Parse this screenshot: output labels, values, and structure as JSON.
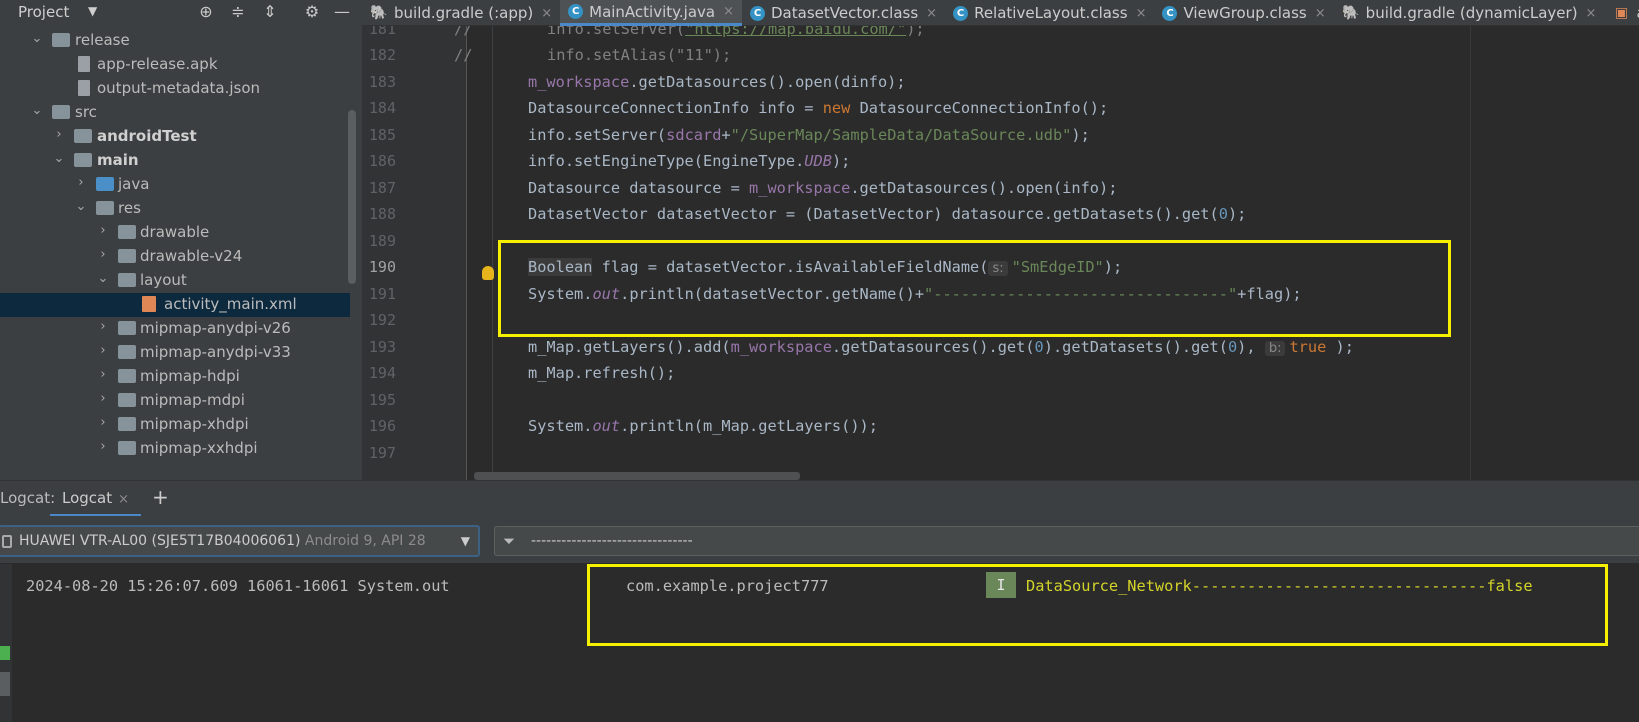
{
  "project_panel": {
    "title": "Project",
    "caret": "▼",
    "tools": [
      "⊕",
      "≑",
      "⇕",
      "⚙",
      "—"
    ]
  },
  "tabs": [
    {
      "label": "build.gradle (:app)",
      "icon": "gradle-icon",
      "close": "×",
      "active": false
    },
    {
      "label": "MainActivity.java",
      "icon": "class-icon",
      "close": "×",
      "active": true
    },
    {
      "label": "DatasetVector.class",
      "icon": "class-icon",
      "close": "×",
      "active": false
    },
    {
      "label": "RelativeLayout.class",
      "icon": "class-icon",
      "close": "×",
      "active": false
    },
    {
      "label": "ViewGroup.class",
      "icon": "class-icon",
      "close": "×",
      "active": false
    },
    {
      "label": "build.gradle (dynamicLayer)",
      "icon": "gradle-icon",
      "close": "×",
      "active": false
    },
    {
      "label": "act",
      "icon": "layout-icon",
      "close": "",
      "active": false
    }
  ],
  "tree": [
    {
      "label": "release",
      "arrow": "⌄",
      "bold": false
    },
    {
      "label": "app-release.apk",
      "arrow": "",
      "bold": false
    },
    {
      "label": "output-metadata.json",
      "arrow": "",
      "bold": false
    },
    {
      "label": "src",
      "arrow": "⌄",
      "bold": false
    },
    {
      "label": "androidTest",
      "arrow": "›",
      "bold": true
    },
    {
      "label": "main",
      "arrow": "⌄",
      "bold": true
    },
    {
      "label": "java",
      "arrow": "›",
      "bold": false
    },
    {
      "label": "res",
      "arrow": "⌄",
      "bold": false
    },
    {
      "label": "drawable",
      "arrow": "›",
      "bold": false
    },
    {
      "label": "drawable-v24",
      "arrow": "›",
      "bold": false
    },
    {
      "label": "layout",
      "arrow": "⌄",
      "bold": false
    },
    {
      "label": "activity_main.xml",
      "arrow": "",
      "bold": false
    },
    {
      "label": "mipmap-anydpi-v26",
      "arrow": "›",
      "bold": false
    },
    {
      "label": "mipmap-anydpi-v33",
      "arrow": "›",
      "bold": false
    },
    {
      "label": "mipmap-hdpi",
      "arrow": "›",
      "bold": false
    },
    {
      "label": "mipmap-mdpi",
      "arrow": "›",
      "bold": false
    },
    {
      "label": "mipmap-xhdpi",
      "arrow": "›",
      "bold": false
    },
    {
      "label": "mipmap-xxhdpi",
      "arrow": "›",
      "bold": false
    }
  ],
  "editor": {
    "line_numbers": [
      "181",
      "182",
      "183",
      "184",
      "185",
      "186",
      "187",
      "188",
      "189",
      "190",
      "191",
      "192",
      "193",
      "194",
      "195",
      "196",
      "197"
    ],
    "current_line": "190",
    "code": {
      "l181_comment": "//",
      "l181_a": "info.setServer(",
      "l181_url": "\"https://map.baidu.com/\"",
      "l181_b": ");",
      "l182_comment": "//",
      "l182_a": "info.setAlias(",
      "l182_str": "\"11\"",
      "l182_b": ");",
      "l183_field": "m_workspace",
      "l183_a": ".getDatasources().open(dinfo);",
      "l184_a": "DatasourceConnectionInfo info = ",
      "l184_kw": "new",
      "l184_b": " DatasourceConnectionInfo();",
      "l185_a": "info.setServer(",
      "l185_field": "sdcard",
      "l185_b": "+",
      "l185_str": "\"/SuperMap/SampleData/DataSource.udb\"",
      "l185_c": ");",
      "l186_a": "info.setEngineType(EngineType.",
      "l186_static": "UDB",
      "l186_b": ");",
      "l187_a": "Datasource datasource = ",
      "l187_field": "m_workspace",
      "l187_b": ".getDatasources().open(info);",
      "l188_a": "DatasetVector datasetVector = (DatasetVector) datasource.getDatasets().get(",
      "l188_num": "0",
      "l188_b": ");",
      "l190_type": "Boolean",
      "l190_a": " flag = datasetVector.isAvailableFieldName(",
      "l190_hint": "s:",
      "l190_str": "\"SmEdgeID\"",
      "l190_b": ");",
      "l191_a": "System.",
      "l191_static": "out",
      "l191_b": ".println(datasetVector.getName()+",
      "l191_str": "\"--------------------------------\"",
      "l191_c": "+flag);",
      "l193_a": "m_Map.getLayers().add(",
      "l193_field": "m_workspace",
      "l193_b": ".getDatasources().get(",
      "l193_num1": "0",
      "l193_c": ").getDatasets().get(",
      "l193_num2": "0",
      "l193_d": "),",
      "l193_hint": "b:",
      "l193_kw": "true",
      "l193_e": " );",
      "l194_a": "m_Map.refresh();",
      "l196_a": "System.",
      "l196_static": "out",
      "l196_b": ".println(m_Map.getLayers());"
    }
  },
  "logcat": {
    "title": "Logcat:",
    "tab_label": "Logcat",
    "tab_close": "×",
    "add": "+",
    "device_name": "HUAWEI VTR-AL00 (SJE5T17B04006061)",
    "device_sub": " Android 9, API 28",
    "device_caret": "▼",
    "filter_value": "--------------------------------",
    "filter_icon": "funnel-icon",
    "entry": {
      "timestamp": "2024-08-20 15:26:07.609 16061-16061 System.out",
      "package": "com.example.project777",
      "level": "I",
      "message": "DataSource_Network--------------------------------false"
    }
  },
  "colors": {
    "highlight_box": "#f4f000",
    "accent": "#4a88c7",
    "log_info_message": "#d4d42a"
  }
}
